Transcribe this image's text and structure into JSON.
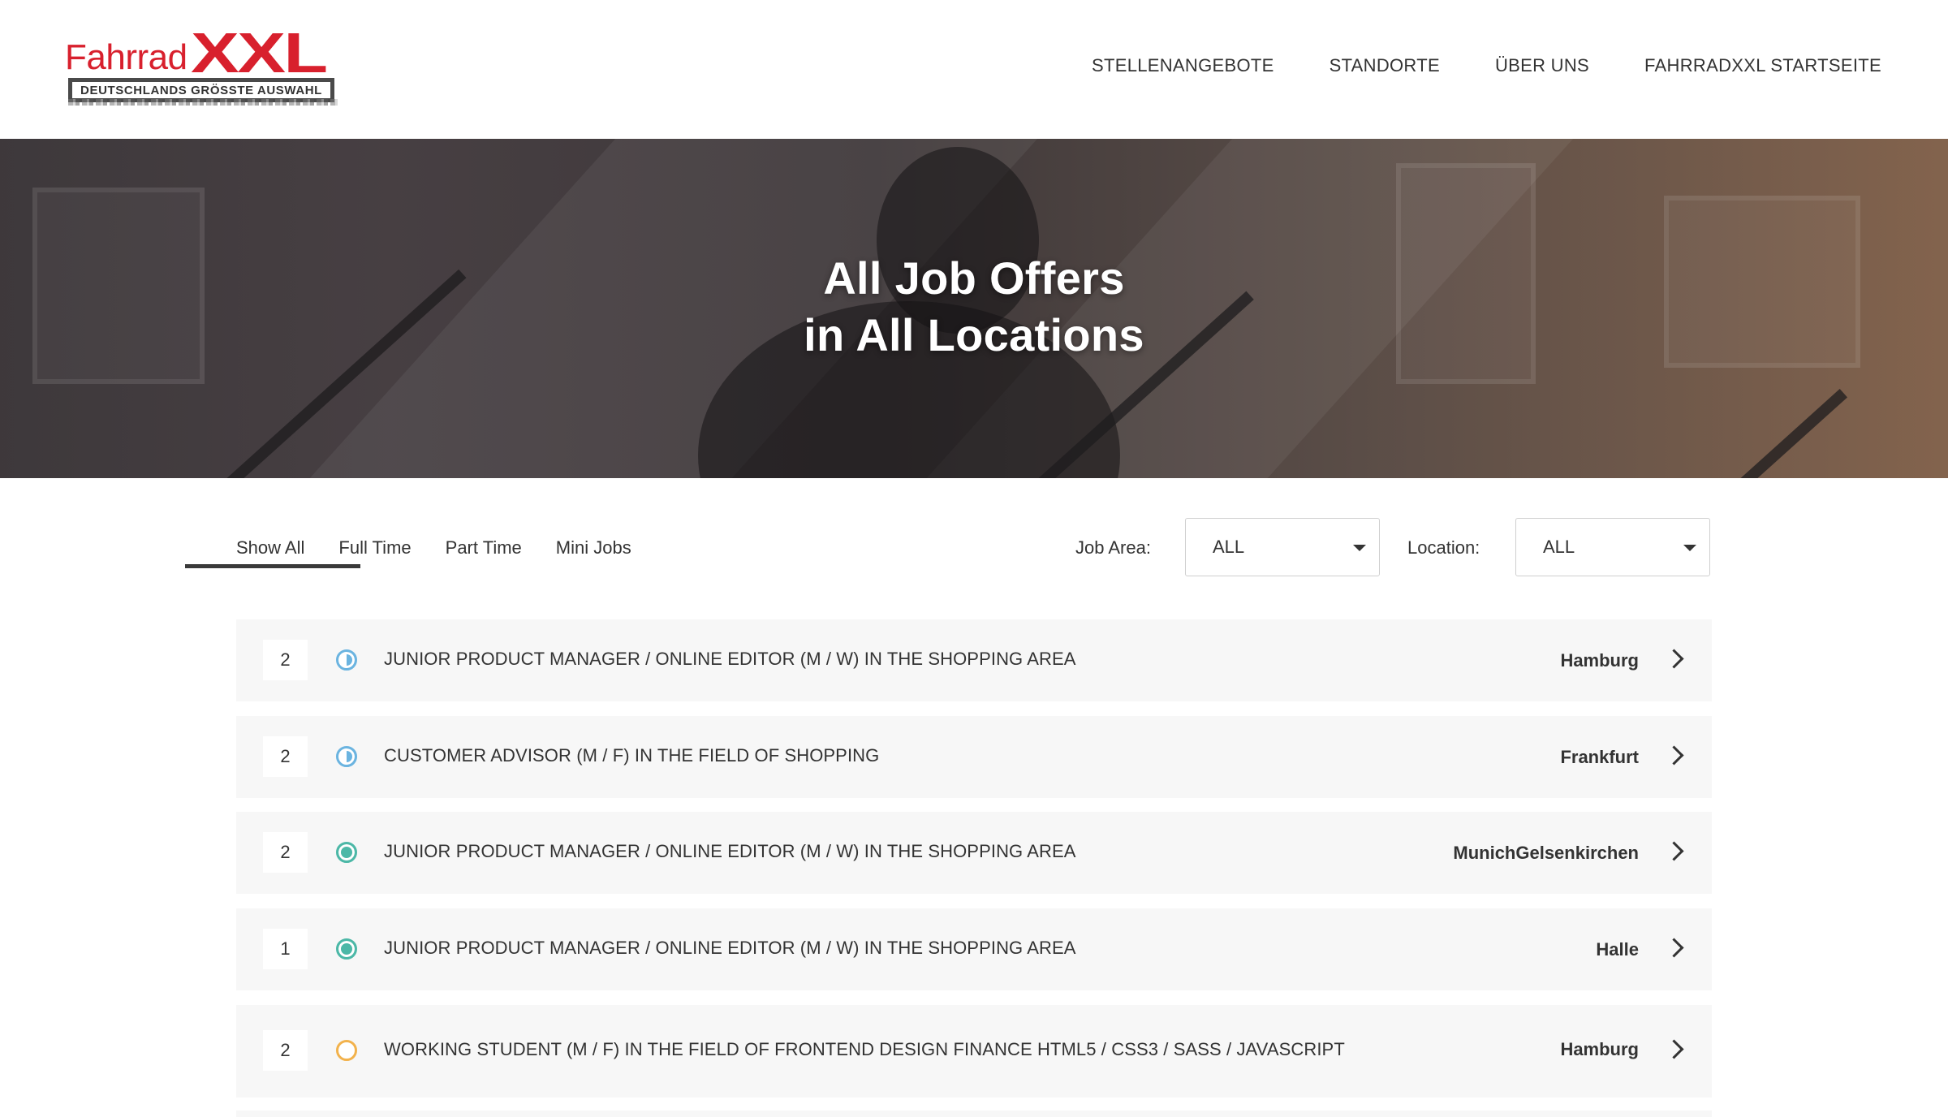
{
  "brand": {
    "logo_word": "Fahrrad",
    "logo_mark": "XXL",
    "logo_tagline": "DEUTSCHLANDS GRÖSSTE AUSWAHL",
    "accent_color": "#d8202d"
  },
  "nav": {
    "items": [
      {
        "label": "STELLENANGEBOTE"
      },
      {
        "label": "STANDORTE"
      },
      {
        "label": "ÜBER UNS"
      },
      {
        "label": "FAHRRADXXL STARTSEITE"
      }
    ]
  },
  "hero": {
    "title_line1": "All Job Offers",
    "title_line2": "in All Locations"
  },
  "filters": {
    "tabs": [
      {
        "label": "Show All",
        "active": true
      },
      {
        "label": "Full Time"
      },
      {
        "label": "Part Time"
      },
      {
        "label": "Mini Jobs"
      }
    ],
    "job_area_label": "Job Area:",
    "job_area_value": "ALL",
    "location_label": "Location:",
    "location_value": "ALL"
  },
  "jobs": [
    {
      "count": "2",
      "icon": "half-circle-icon",
      "title": "JUNIOR PRODUCT MANAGER / ONLINE EDITOR (M / W) IN THE SHOPPING AREA",
      "location": "Hamburg"
    },
    {
      "count": "2",
      "icon": "half-circle-icon",
      "title": "CUSTOMER ADVISOR (M / F) IN THE FIELD OF SHOPPING",
      "location": "Frankfurt"
    },
    {
      "count": "2",
      "icon": "full-circle-icon",
      "title": "JUNIOR PRODUCT MANAGER / ONLINE EDITOR (M / W) IN THE SHOPPING AREA",
      "location": "MunichGelsenkirchen"
    },
    {
      "count": "1",
      "icon": "full-circle-icon",
      "title": "JUNIOR PRODUCT MANAGER / ONLINE EDITOR (M / W) IN THE SHOPPING AREA",
      "location": "Halle"
    },
    {
      "count": "2",
      "icon": "empty-circle-icon",
      "title": "WORKING STUDENT (M / F) IN THE FIELD OF FRONTEND DESIGN FINANCE HTML5 / CSS3 / SASS / JAVASCRIPT",
      "location": "Hamburg"
    }
  ]
}
